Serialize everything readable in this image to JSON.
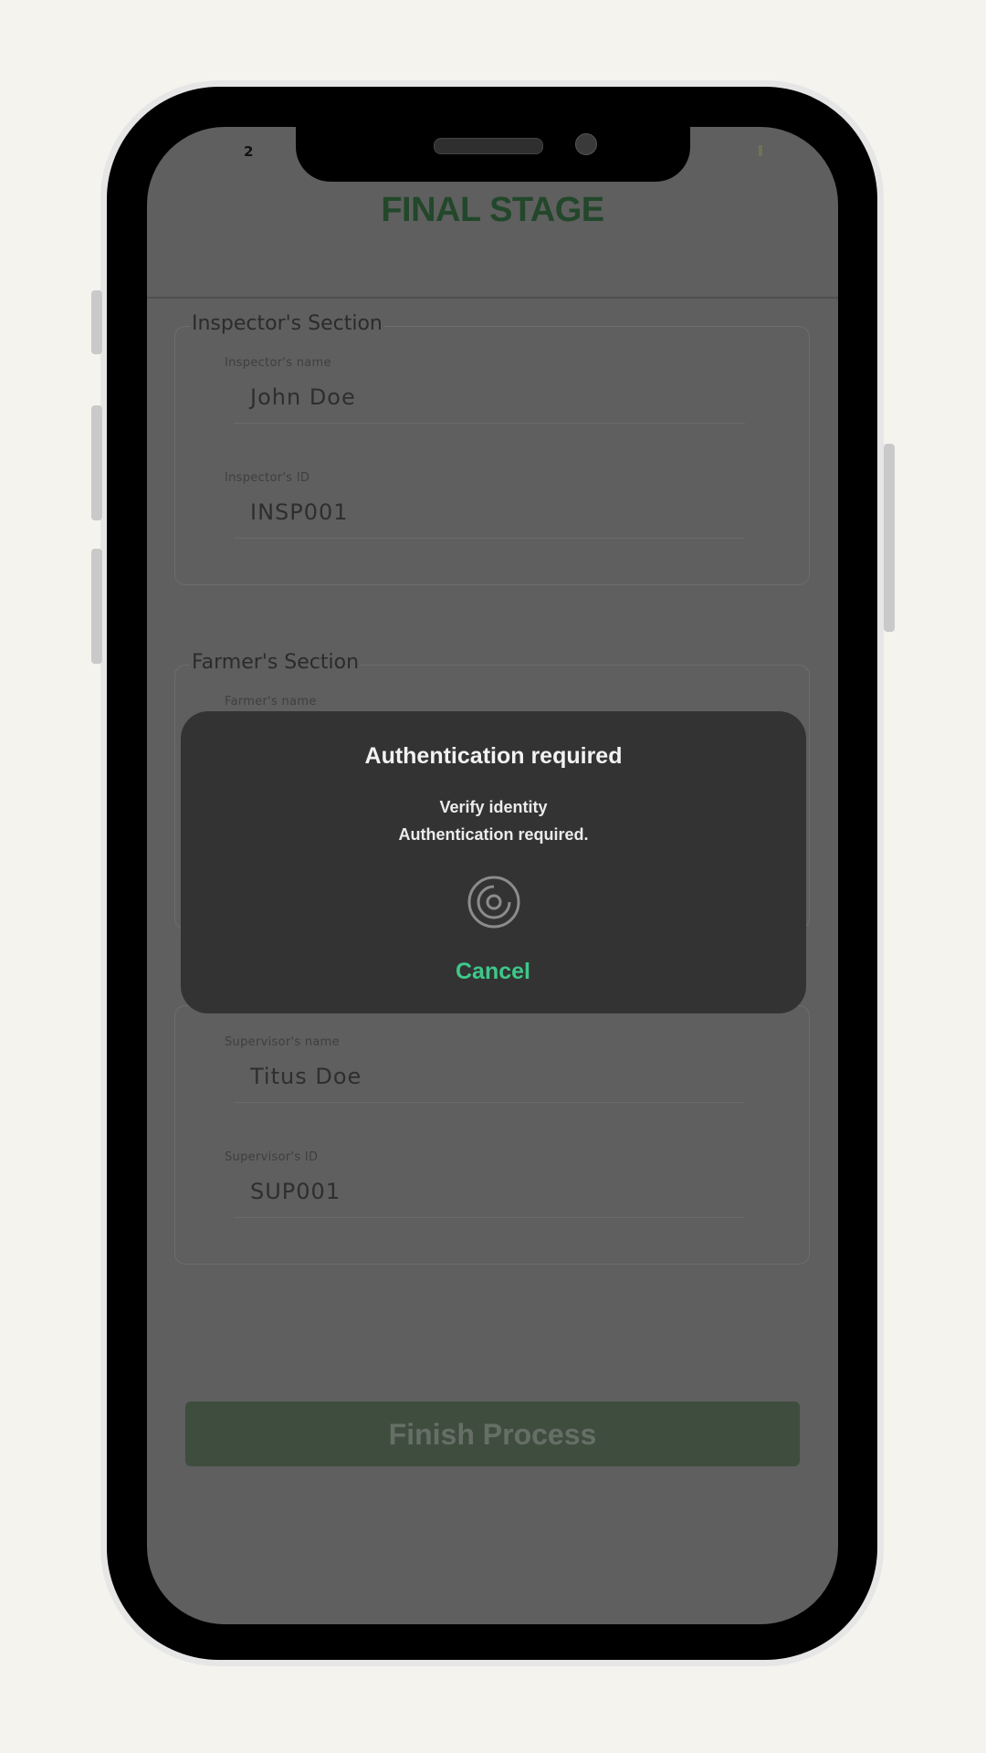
{
  "status_bar": {
    "time": "2"
  },
  "header": {
    "title": "FINAL STAGE"
  },
  "inspector_section": {
    "legend": "Inspector's Section",
    "name_label": "Inspector's name",
    "name_value": "John Doe",
    "id_label": "Inspector's ID",
    "id_value": "INSP001"
  },
  "farmer_section": {
    "legend": "Farmer's Section",
    "name_label": "Farmer's name"
  },
  "supervisor_section": {
    "name_label": "Supervisor's name",
    "name_value": "Titus Doe",
    "id_label": "Supervisor's ID",
    "id_value": "SUP001"
  },
  "finish_button": {
    "label": "Finish Process"
  },
  "auth_dialog": {
    "title": "Authentication required",
    "subtitle": "Verify identity",
    "description": "Authentication required.",
    "icon": "fingerprint-icon",
    "cancel_label": "Cancel",
    "accent_color": "#3dc88a"
  }
}
